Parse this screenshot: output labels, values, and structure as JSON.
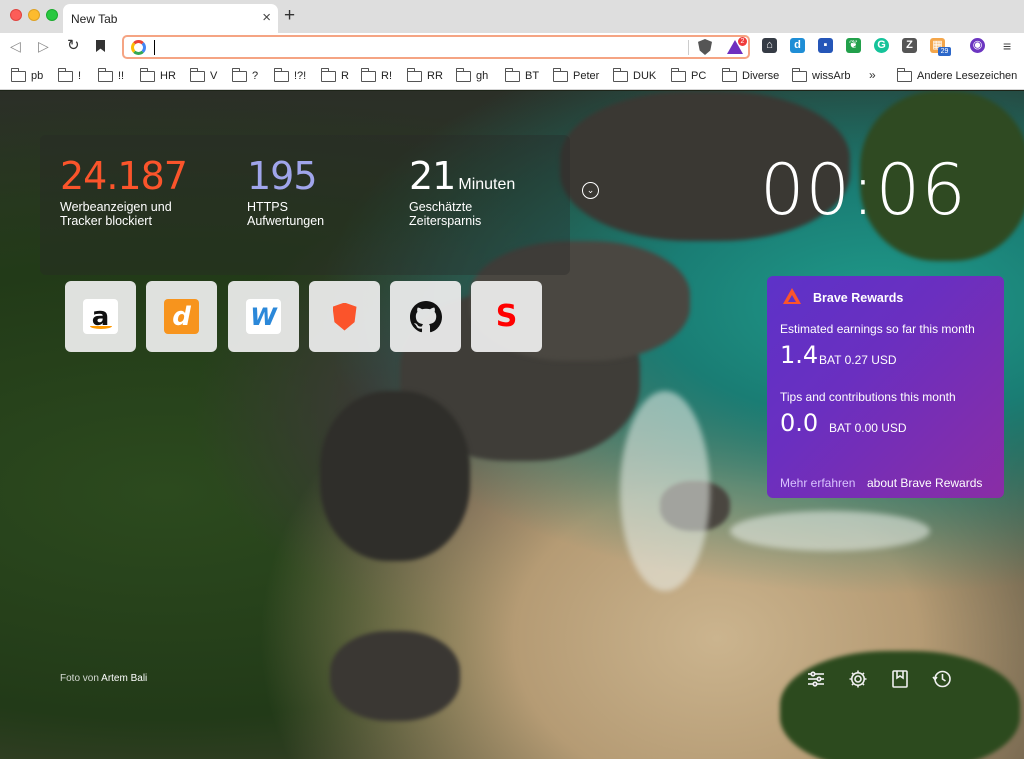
{
  "browser": {
    "tab_title": "New Tab",
    "tab_close": "×",
    "new_tab": "+",
    "nav": {
      "back": "◁",
      "forward": "▷",
      "reload": "↻"
    },
    "url": {
      "value": "",
      "placeholder": ""
    },
    "bat_badge": "2",
    "extensions": [
      {
        "name": "pocket",
        "glyph": "⌂",
        "color": "#353b45"
      },
      {
        "name": "deepl",
        "glyph": "d",
        "color": "#1f8ed6"
      },
      {
        "name": "todoist",
        "glyph": "▪",
        "color": "#2556b8"
      },
      {
        "name": "evernote",
        "glyph": "❦",
        "color": "#22a04b"
      },
      {
        "name": "grammarly",
        "glyph": "G",
        "color": "#15c39a"
      },
      {
        "name": "zotero",
        "glyph": "Z",
        "color": "#555555"
      },
      {
        "name": "calendar",
        "glyph": "▦",
        "color": "#f4a64a"
      },
      {
        "name": "tor",
        "glyph": "◉",
        "color": "#6c36c1"
      }
    ],
    "calendar_badge": "29",
    "menu": "≡"
  },
  "bookmarks": {
    "items": [
      "pb",
      "!",
      "!!",
      "HR",
      "V",
      "?",
      "!?!",
      "R",
      "R!",
      "RR",
      "gh",
      "BT",
      "Peter",
      "DUK",
      "PC",
      "Diverse",
      "wissArb"
    ],
    "more": "»",
    "other": "Andere Lesezeichen"
  },
  "stats": {
    "blocked": {
      "value": "24.187",
      "label": "Werbeanzeigen und Tracker blockiert",
      "color": "#fb542b"
    },
    "https": {
      "value": "195",
      "label": "HTTPS Aufwertungen",
      "color": "#a0a5eb"
    },
    "time": {
      "value": "21",
      "unit": "Minuten",
      "label": "Geschätzte Zeitersparnis",
      "color": "#ffffff"
    }
  },
  "clock": "00:06",
  "top_sites": [
    {
      "name": "amazon",
      "glyph": "a",
      "bg": "#ffffff",
      "fg": "#111111"
    },
    {
      "name": "dict",
      "glyph": "d",
      "bg": "#f7941d",
      "fg": "#ffffff"
    },
    {
      "name": "wunderlist",
      "glyph": "W",
      "bg": "#ffffff",
      "fg": "#2b88d9"
    },
    {
      "name": "brave",
      "glyph": "▼",
      "bg": "#ffffff",
      "fg": "#fb542b"
    },
    {
      "name": "github",
      "glyph": "●",
      "bg": "#ffffff",
      "fg": "#111111"
    },
    {
      "name": "sparkasse",
      "glyph": "S",
      "bg": "#ffffff",
      "fg": "#ff0000"
    }
  ],
  "rewards": {
    "title": "Brave Rewards",
    "earnings_label": "Estimated earnings so far this month",
    "earnings_value": "1.4",
    "earnings_unit": "BAT 0.27 USD",
    "tips_label": "Tips and contributions this month",
    "tips_value": "0.0",
    "tips_unit": "BAT 0.00 USD",
    "link": "Mehr erfahren",
    "about": "about Brave Rewards"
  },
  "credit": {
    "prefix": "Foto von",
    "author": "Artem Bali"
  }
}
